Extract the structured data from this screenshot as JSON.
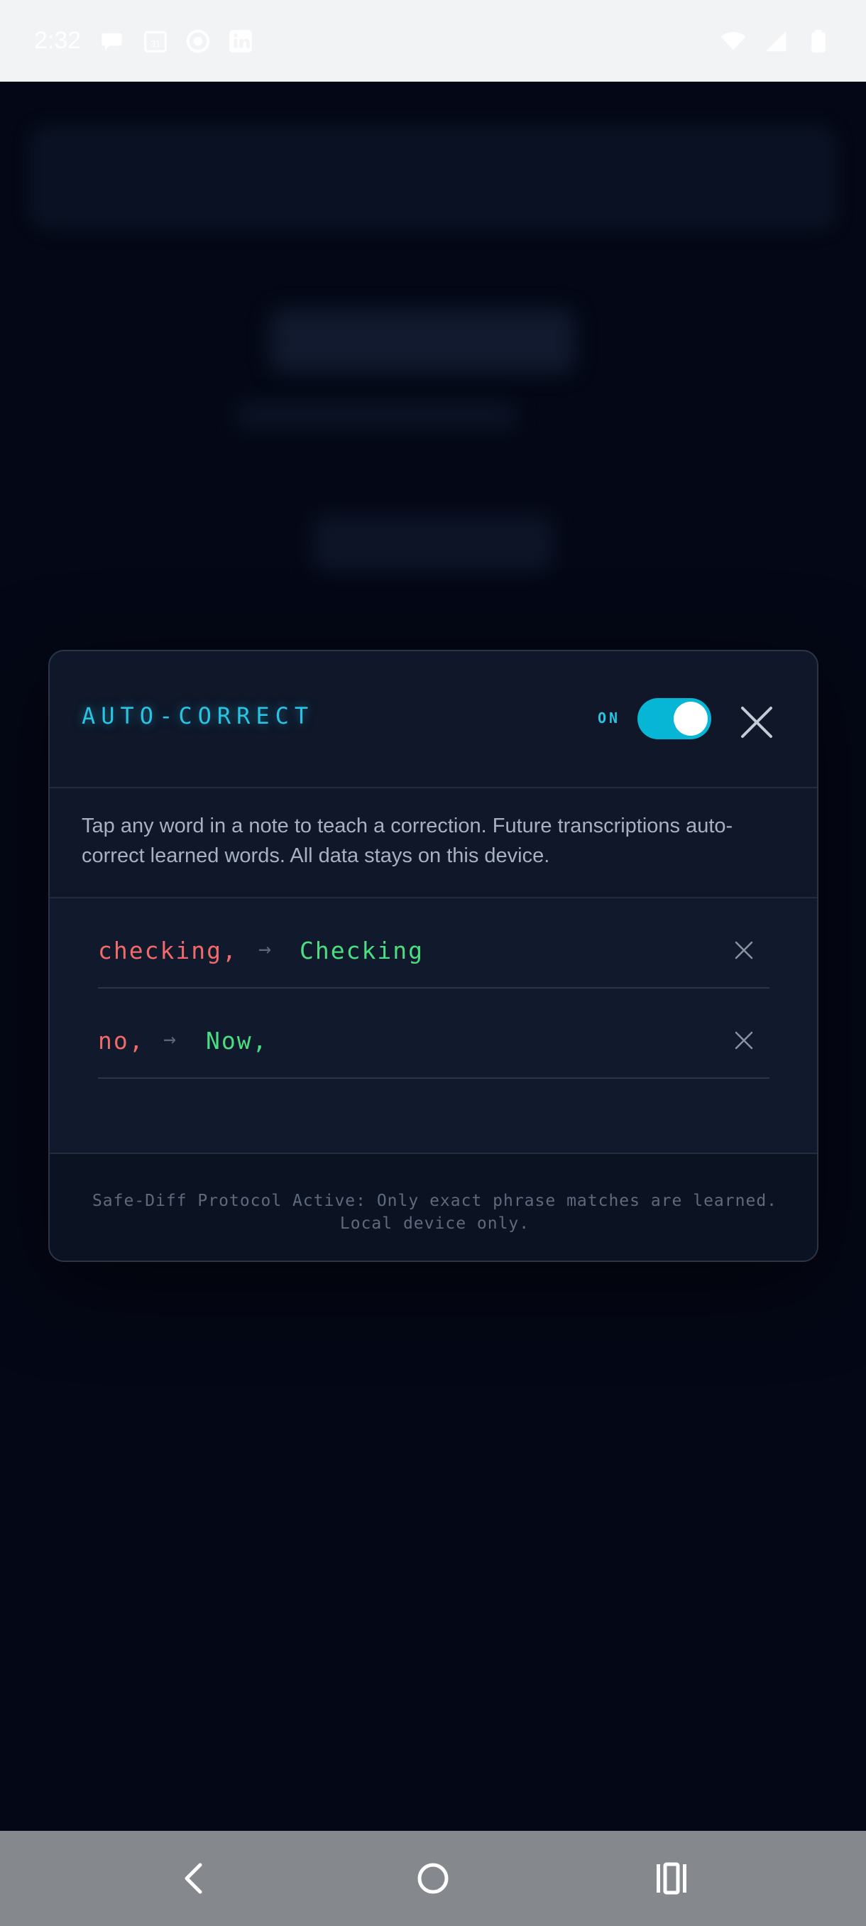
{
  "status_bar": {
    "time": "2:32",
    "left_icons": [
      "chat-bubble-icon",
      "calendar-icon",
      "radio-circle-icon",
      "linkedin-icon"
    ],
    "right_icons": [
      "wifi-icon",
      "cellular-signal-icon",
      "battery-icon"
    ]
  },
  "modal": {
    "title": "AUTO-CORRECT",
    "toggle_label": "ON",
    "toggle_on": true,
    "description": "Tap any word in a note to teach a correction. Future transcriptions auto-correct learned words. All data stays on this device.",
    "rules": [
      {
        "from": "checking,",
        "arrow": "→",
        "to": "Checking"
      },
      {
        "from": "no,",
        "arrow": "→",
        "to": "Now,"
      }
    ],
    "footer": "Safe-Diff Protocol Active: Only exact phrase matches are learned. Local device only."
  },
  "colors": {
    "accent": "#27c4e3",
    "toggle_on": "#06b6d4",
    "wrong_word": "#f06a6a",
    "correct_word": "#4ade80",
    "modal_bg": "#0f1729",
    "page_bg": "#040816"
  },
  "nav_bar": {
    "icons": [
      "back-icon",
      "home-icon",
      "recents-icon"
    ]
  }
}
